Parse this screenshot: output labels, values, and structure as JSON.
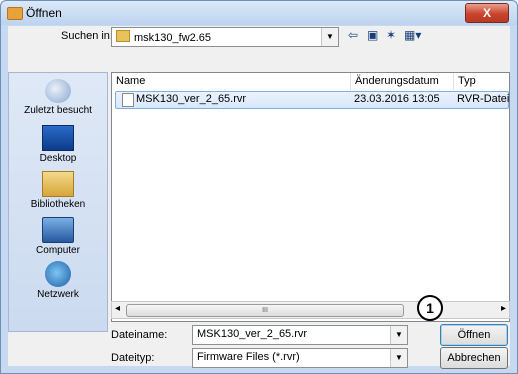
{
  "window": {
    "title": "Öffnen",
    "close_label": "X"
  },
  "lookin": {
    "label": "Suchen in:",
    "value": "msk130_fw2.65"
  },
  "toolbar": {
    "back_icon": "arrow-left-icon",
    "up_icon": "folder-up-icon",
    "newfolder_icon": "new-folder-icon",
    "views_icon": "views-menu-icon"
  },
  "places": [
    {
      "label": "Zuletzt besucht",
      "icon": "recent-places-icon"
    },
    {
      "label": "Desktop",
      "icon": "desktop-icon"
    },
    {
      "label": "Bibliotheken",
      "icon": "libraries-icon"
    },
    {
      "label": "Computer",
      "icon": "computer-icon"
    },
    {
      "label": "Netzwerk",
      "icon": "network-icon"
    }
  ],
  "columns": {
    "name": "Name",
    "date": "Änderungsdatum",
    "type": "Typ"
  },
  "files": [
    {
      "name": "MSK130_ver_2_65.rvr",
      "date": "23.03.2016 13:05",
      "type": "RVR-Datei"
    }
  ],
  "filename": {
    "label": "Dateiname:",
    "value": "MSK130_ver_2_65.rvr"
  },
  "filetype": {
    "label": "Dateityp:",
    "value": "Firmware Files (*.rvr)"
  },
  "buttons": {
    "open": "Öffnen",
    "cancel": "Abbrechen"
  },
  "marker": "1",
  "scrollbar": {
    "left": "◂",
    "right": "▸",
    "thumb": "III"
  }
}
